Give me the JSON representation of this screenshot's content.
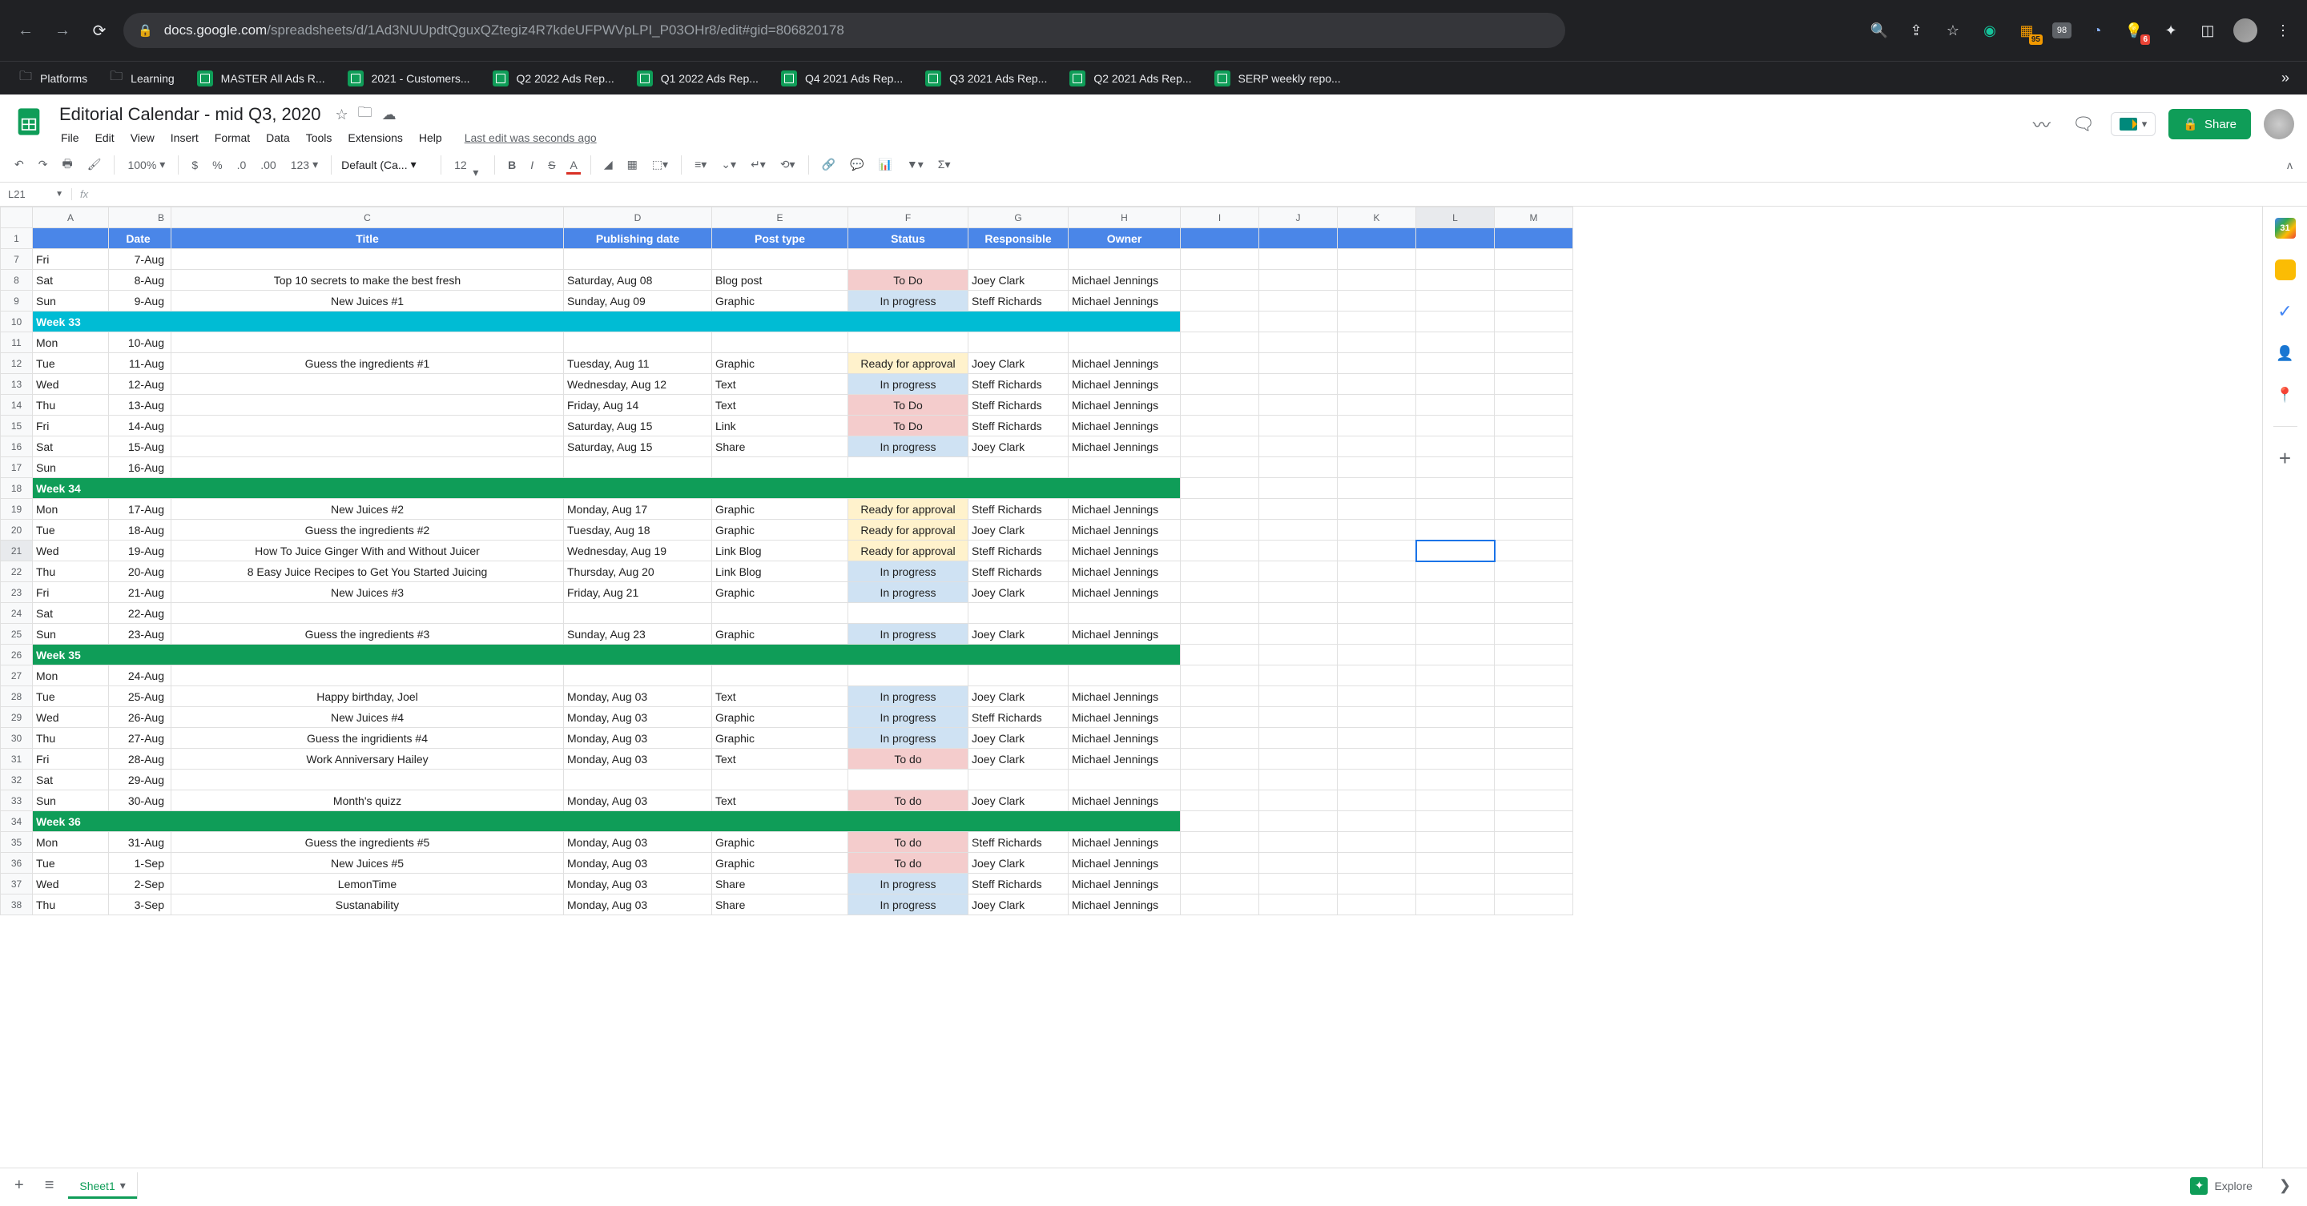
{
  "browser": {
    "url_host": "docs.google.com",
    "url_path": "/spreadsheets/d/1Ad3NUUpdtQguxQZtegiz4R7kdeUFPWVpLPI_P03OHr8/edit#gid=806820178",
    "badge95": "95",
    "badge6": "6",
    "ext98": "98"
  },
  "bookmarks": [
    {
      "label": "Platforms",
      "type": "folder"
    },
    {
      "label": "Learning",
      "type": "folder"
    },
    {
      "label": "MASTER All Ads R...",
      "type": "sheets"
    },
    {
      "label": "2021 - Customers...",
      "type": "sheets"
    },
    {
      "label": "Q2 2022 Ads Rep...",
      "type": "sheets"
    },
    {
      "label": "Q1 2022 Ads Rep...",
      "type": "sheets"
    },
    {
      "label": "Q4 2021 Ads Rep...",
      "type": "sheets"
    },
    {
      "label": "Q3 2021 Ads Rep...",
      "type": "sheets"
    },
    {
      "label": "Q2 2021 Ads Rep...",
      "type": "sheets"
    },
    {
      "label": "SERP weekly repo...",
      "type": "sheets"
    }
  ],
  "doc": {
    "title": "Editorial Calendar - mid Q3, 2020",
    "menus": [
      "File",
      "Edit",
      "View",
      "Insert",
      "Format",
      "Data",
      "Tools",
      "Extensions",
      "Help"
    ],
    "last_edit": "Last edit was seconds ago",
    "share": "Share"
  },
  "toolbar": {
    "zoom": "100%",
    "font": "Default (Ca...",
    "size": "12",
    "more": "123"
  },
  "fx": {
    "cell": "L21"
  },
  "columns": [
    "A",
    "B",
    "C",
    "D",
    "E",
    "F",
    "G",
    "H",
    "I",
    "J",
    "K",
    "L",
    "M"
  ],
  "col_headers": {
    "A": "",
    "B": "Date",
    "C": "Title",
    "D": "Publishing date",
    "E": "Post type",
    "F": "Status",
    "G": "Responsible",
    "H": "Owner"
  },
  "selected_col": "L",
  "rows": [
    {
      "n": 7,
      "A": "Fri",
      "B": "7-Aug"
    },
    {
      "n": 8,
      "A": "Sat",
      "B": "8-Aug",
      "C": "Top 10 secrets to make the best fresh",
      "D": "Saturday, Aug 08",
      "E": "Blog post",
      "F": "To Do",
      "Fc": "st-todo",
      "G": "Joey Clark",
      "H": "Michael Jennings"
    },
    {
      "n": 9,
      "A": "Sun",
      "B": "9-Aug",
      "C": "New Juices #1",
      "D": "Sunday, Aug 09",
      "E": "Graphic",
      "F": "In progress",
      "Fc": "st-prog",
      "G": "Steff Richards",
      "H": "Michael Jennings"
    },
    {
      "n": 10,
      "week": "Week 33",
      "wc": "week33"
    },
    {
      "n": 11,
      "A": "Mon",
      "B": "10-Aug"
    },
    {
      "n": 12,
      "A": "Tue",
      "B": "11-Aug",
      "C": "Guess the ingredients #1",
      "D": "Tuesday, Aug 11",
      "E": "Graphic",
      "F": "Ready for approval",
      "Fc": "st-ready",
      "G": "Joey Clark",
      "H": "Michael Jennings"
    },
    {
      "n": 13,
      "A": "Wed",
      "B": "12-Aug",
      "D": "Wednesday, Aug 12",
      "E": "Text",
      "F": "In progress",
      "Fc": "st-prog",
      "G": "Steff Richards",
      "H": "Michael Jennings"
    },
    {
      "n": 14,
      "A": "Thu",
      "B": "13-Aug",
      "D": "Friday, Aug 14",
      "E": "Text",
      "F": "To Do",
      "Fc": "st-todo",
      "G": "Steff Richards",
      "H": "Michael Jennings"
    },
    {
      "n": 15,
      "A": "Fri",
      "B": "14-Aug",
      "D": "Saturday, Aug 15",
      "E": "Link",
      "F": "To Do",
      "Fc": "st-todo",
      "G": "Steff Richards",
      "H": "Michael Jennings"
    },
    {
      "n": 16,
      "A": "Sat",
      "B": "15-Aug",
      "D": "Saturday, Aug 15",
      "E": "Share",
      "F": "In progress",
      "Fc": "st-prog",
      "G": "Joey Clark",
      "H": "Michael Jennings"
    },
    {
      "n": 17,
      "A": "Sun",
      "B": "16-Aug"
    },
    {
      "n": 18,
      "week": "Week 34"
    },
    {
      "n": 19,
      "A": "Mon",
      "B": "17-Aug",
      "C": "New Juices #2",
      "D": "Monday, Aug 17",
      "E": "Graphic",
      "F": "Ready for approval",
      "Fc": "st-ready",
      "G": "Steff Richards",
      "H": "Michael Jennings"
    },
    {
      "n": 20,
      "A": "Tue",
      "B": "18-Aug",
      "C": "Guess the ingredients #2",
      "D": "Tuesday, Aug 18",
      "E": "Graphic",
      "F": "Ready for approval",
      "Fc": "st-ready",
      "G": "Joey Clark",
      "H": "Michael Jennings"
    },
    {
      "n": 21,
      "A": "Wed",
      "B": "19-Aug",
      "C": "How To Juice Ginger With and Without Juicer",
      "D": "Wednesday, Aug 19",
      "E": "Link Blog",
      "F": "Ready for approval",
      "Fc": "st-ready",
      "G": "Steff Richards",
      "H": "Michael Jennings",
      "sel": true
    },
    {
      "n": 22,
      "A": "Thu",
      "B": "20-Aug",
      "C": "8 Easy Juice Recipes to Get You Started Juicing",
      "D": "Thursday, Aug 20",
      "E": "Link Blog",
      "F": "In progress",
      "Fc": "st-prog",
      "G": "Steff Richards",
      "H": "Michael Jennings"
    },
    {
      "n": 23,
      "A": "Fri",
      "B": "21-Aug",
      "C": "New Juices #3",
      "D": "Friday, Aug 21",
      "E": "Graphic",
      "F": "In progress",
      "Fc": "st-prog",
      "G": "Joey Clark",
      "H": "Michael Jennings"
    },
    {
      "n": 24,
      "A": "Sat",
      "B": "22-Aug"
    },
    {
      "n": 25,
      "A": "Sun",
      "B": "23-Aug",
      "C": "Guess the ingredients #3",
      "D": "Sunday, Aug 23",
      "E": "Graphic",
      "F": "In progress",
      "Fc": "st-prog",
      "G": "Joey Clark",
      "H": "Michael Jennings"
    },
    {
      "n": 26,
      "week": "Week 35"
    },
    {
      "n": 27,
      "A": "Mon",
      "B": "24-Aug"
    },
    {
      "n": 28,
      "A": "Tue",
      "B": "25-Aug",
      "C": "Happy birthday, Joel",
      "D": "Monday, Aug 03",
      "E": "Text",
      "F": "In progress",
      "Fc": "st-prog",
      "G": "Joey Clark",
      "H": "Michael Jennings"
    },
    {
      "n": 29,
      "A": "Wed",
      "B": "26-Aug",
      "C": "New Juices #4",
      "D": "Monday, Aug 03",
      "E": "Graphic",
      "F": "In progress",
      "Fc": "st-prog",
      "G": "Steff Richards",
      "H": "Michael Jennings"
    },
    {
      "n": 30,
      "A": "Thu",
      "B": "27-Aug",
      "C": "Guess the ingridients #4",
      "D": "Monday, Aug 03",
      "E": "Graphic",
      "F": "In progress",
      "Fc": "st-prog",
      "G": "Joey Clark",
      "H": "Michael Jennings"
    },
    {
      "n": 31,
      "A": "Fri",
      "B": "28-Aug",
      "C": "Work Anniversary Hailey",
      "D": "Monday, Aug 03",
      "E": "Text",
      "F": "To do",
      "Fc": "st-todo",
      "G": "Joey Clark",
      "H": "Michael Jennings"
    },
    {
      "n": 32,
      "A": "Sat",
      "B": "29-Aug"
    },
    {
      "n": 33,
      "A": "Sun",
      "B": "30-Aug",
      "C": "Month's quizz",
      "D": "Monday, Aug 03",
      "E": "Text",
      "F": "To do",
      "Fc": "st-todo",
      "G": "Joey Clark",
      "H": "Michael Jennings"
    },
    {
      "n": 34,
      "week": "Week 36"
    },
    {
      "n": 35,
      "A": "Mon",
      "B": "31-Aug",
      "C": "Guess the ingredients #5",
      "D": "Monday, Aug 03",
      "E": "Graphic",
      "F": "To do",
      "Fc": "st-todo",
      "G": "Steff Richards",
      "H": "Michael Jennings"
    },
    {
      "n": 36,
      "A": "Tue",
      "B": "1-Sep",
      "C": "New Juices #5",
      "D": "Monday, Aug 03",
      "E": "Graphic",
      "F": "To do",
      "Fc": "st-todo",
      "G": "Joey Clark",
      "H": "Michael Jennings"
    },
    {
      "n": 37,
      "A": "Wed",
      "B": "2-Sep",
      "C": "LemonTime",
      "D": "Monday, Aug 03",
      "E": "Share",
      "F": "In progress",
      "Fc": "st-prog",
      "G": "Steff Richards",
      "H": "Michael Jennings"
    },
    {
      "n": 38,
      "A": "Thu",
      "B": "3-Sep",
      "C": "Sustanability",
      "D": "Monday, Aug 03",
      "E": "Share",
      "F": "In progress",
      "Fc": "st-prog",
      "G": "Joey Clark",
      "H": "Michael Jennings"
    }
  ],
  "tabs": {
    "sheet": "Sheet1",
    "explore": "Explore"
  },
  "side_cal": "31"
}
